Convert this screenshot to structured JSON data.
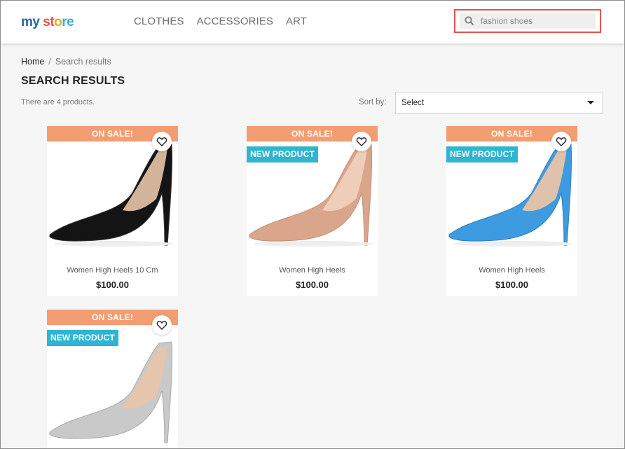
{
  "header": {
    "logo": {
      "part1": "my",
      "part2": "st",
      "part3": "o",
      "part4": "re"
    },
    "nav": [
      "CLOTHES",
      "ACCESSORIES",
      "ART"
    ],
    "search": {
      "value": "fashion shoes",
      "icon": "search-icon"
    }
  },
  "breadcrumb": {
    "home": "Home",
    "separator": "/",
    "current": "Search results"
  },
  "page_title": "SEARCH RESULTS",
  "product_count": "There are 4 products.",
  "sort": {
    "label": "Sort by:",
    "selected": "Select"
  },
  "colors": {
    "sale": "#f39d72",
    "new": "#2fb5d2",
    "highlight": "#e8524b"
  },
  "products": [
    {
      "sale": "ON SALE!",
      "new": "",
      "name": "Women High Heels 10 Cm",
      "price": "$100.00",
      "shoe_color": "#141414",
      "shoe_shade": "#3a3a3a"
    },
    {
      "sale": "ON SALE!",
      "new": "NEW PRODUCT",
      "name": "Women High Heels",
      "price": "$100.00",
      "shoe_color": "#d9a68c",
      "shoe_shade": "#c48d74"
    },
    {
      "sale": "ON SALE!",
      "new": "NEW PRODUCT",
      "name": "Women High Heels",
      "price": "$100.00",
      "shoe_color": "#3e9be0",
      "shoe_shade": "#2a7fc4"
    },
    {
      "sale": "ON SALE!",
      "new": "NEW PRODUCT",
      "name": "",
      "price": "",
      "shoe_color": "#c9c9c9",
      "shoe_shade": "#a8a8a8"
    }
  ]
}
